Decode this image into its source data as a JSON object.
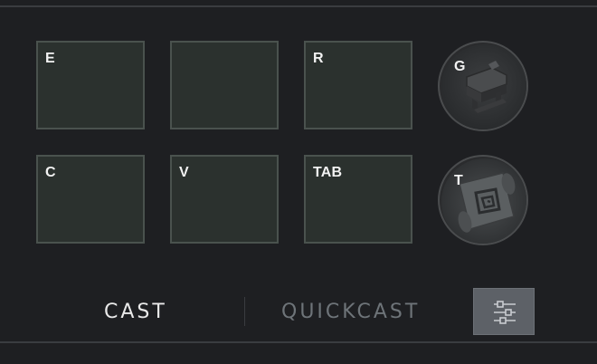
{
  "slots": [
    {
      "key": "E"
    },
    {
      "key": ""
    },
    {
      "key": "R"
    },
    {
      "key": "C"
    },
    {
      "key": "V"
    },
    {
      "key": "TAB"
    }
  ],
  "items": [
    {
      "key": "G",
      "icon": "anvil-icon"
    },
    {
      "key": "T",
      "icon": "scroll-icon"
    }
  ],
  "cast_modes": {
    "cast": "CAST",
    "quickcast": "QUICKCAST",
    "selected": "cast"
  },
  "settings": {
    "icon": "sliders-icon"
  },
  "colors": {
    "background": "#1e1f22",
    "slot_fill": "#2b312e",
    "slot_border": "#4a524e",
    "settings_button": "#5d6167"
  }
}
